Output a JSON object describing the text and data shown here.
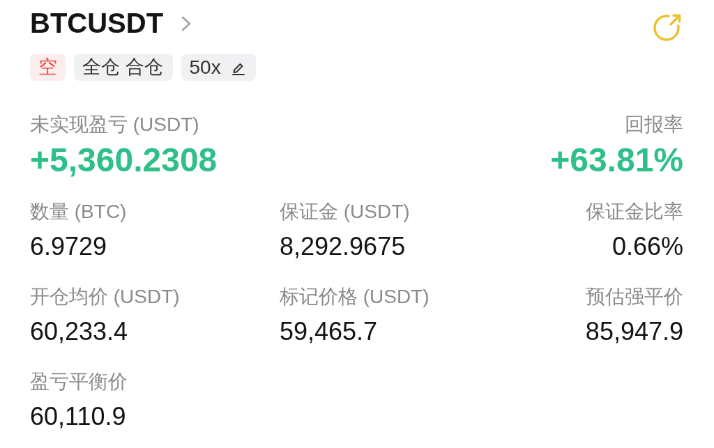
{
  "header": {
    "symbol": "BTCUSDT"
  },
  "tags": [
    {
      "kind": "side",
      "label": "空"
    },
    {
      "kind": "mode",
      "label": "全仓 合仓"
    },
    {
      "kind": "leverage",
      "label": "50x"
    }
  ],
  "pnl": {
    "label": "未实现盈亏 (USDT)",
    "value": "+5,360.2308"
  },
  "roe": {
    "label": "回报率",
    "value": "+63.81%"
  },
  "fields": [
    {
      "label": "数量 (BTC)",
      "value": "6.9729"
    },
    {
      "label": "保证金 (USDT)",
      "value": "8,292.9675"
    },
    {
      "label": "保证金比率",
      "value": "0.66%"
    },
    {
      "label": "开仓均价 (USDT)",
      "value": "60,233.4"
    },
    {
      "label": "标记价格 (USDT)",
      "value": "59,465.7"
    },
    {
      "label": "预估强平价",
      "value": "85,947.9"
    },
    {
      "label": "盈亏平衡价",
      "value": "60,110.9"
    }
  ]
}
